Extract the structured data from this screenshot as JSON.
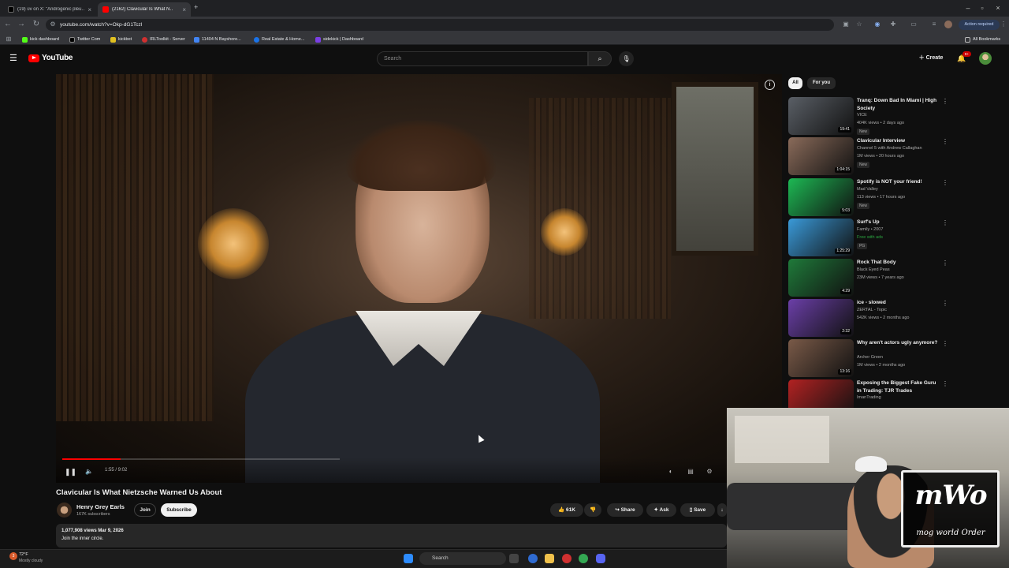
{
  "browser": {
    "tabs": [
      {
        "title": "(19) ᴜv on X: \"Androgenic pleu…",
        "active": false
      },
      {
        "title": "(2162) Clavicular Is What N…",
        "active": true
      }
    ],
    "url": "youtube.com/watch?v=Okp-dG1Tczl",
    "action_required": "Action required",
    "all_bookmarks": "All Bookmarks",
    "bookmarks": [
      "kick dashboard",
      "Twitter Com",
      "kickbot",
      "IRLToolkit - Server",
      "11404 N Bayshore...",
      "Real Estate & Home...",
      "sidekick | Dashboard"
    ]
  },
  "youtube": {
    "logo_text": "YouTube",
    "search_placeholder": "Search",
    "create_label": "Create",
    "notif_count": "9+"
  },
  "player": {
    "time": "1:55 / 9:02",
    "progress_fraction": 0.21
  },
  "video": {
    "title": "Clavicular Is What Nietzsche Warned Us About",
    "channel": "Henry Grey Earls",
    "subscribers": "167K subscribers",
    "join_label": "Join",
    "subscribe_label": "Subscribe",
    "likes": "61K",
    "share_label": "Share",
    "ask_label": "Ask",
    "save_label": "Save",
    "views_date": "1,077,908 views  Mar 9, 2026",
    "description": "Join the inner circle."
  },
  "sidebar": {
    "chips": [
      "All",
      "For you"
    ],
    "recommendations": [
      {
        "title": "Tranq: Down Bad In Miami | High Society",
        "channel": "VICE",
        "meta": "404K views • 2 days ago",
        "badge": "New",
        "duration": "19:41",
        "thumb_color": "#5a5f66"
      },
      {
        "title": "Clavicular Interview",
        "channel": "Channel 5 with Andrew Callaghan",
        "meta": "1M views • 20 hours ago",
        "badge": "New",
        "duration": "1:04:15",
        "thumb_color": "#8a6b5a"
      },
      {
        "title": "Spotify is NOT your friend!",
        "channel": "Mad Valley",
        "meta": "113 views • 17 hours ago",
        "badge": "New",
        "duration": "5:03",
        "thumb_color": "#1db954"
      },
      {
        "title": "Surf's Up",
        "channel": "Family • 2007",
        "meta": "Free with ads",
        "badge": "PG",
        "duration": "1:25:29",
        "thumb_color": "#3a9ad9"
      },
      {
        "title": "Rock That Body",
        "channel": "Black Eyed Peas",
        "meta": "23M views • 7 years ago",
        "badge": "",
        "duration": "4:29",
        "thumb_color": "#1f7a3a"
      },
      {
        "title": "ice - slowed",
        "channel": "ZERTAL - Topic",
        "meta": "542K views • 2 months ago",
        "badge": "",
        "duration": "2:32",
        "thumb_color": "#6b3fa8"
      },
      {
        "title": "Why aren't actors ugly anymore?",
        "channel": "Archer Green",
        "meta": "1M views • 2 months ago",
        "badge": "",
        "duration": "13:16",
        "thumb_color": "#7a5a48"
      },
      {
        "title": "Exposing the Biggest Fake Guru in Trading: TJR Trades",
        "channel": "ImanTrading",
        "meta": "",
        "badge": "",
        "duration": "",
        "thumb_color": "#b22222"
      }
    ]
  },
  "overlay": {
    "logo_big": "mWo",
    "logo_small": "mog world Order"
  },
  "taskbar": {
    "temperature": "72°F",
    "weather": "Mostly cloudy",
    "search": "Search"
  }
}
